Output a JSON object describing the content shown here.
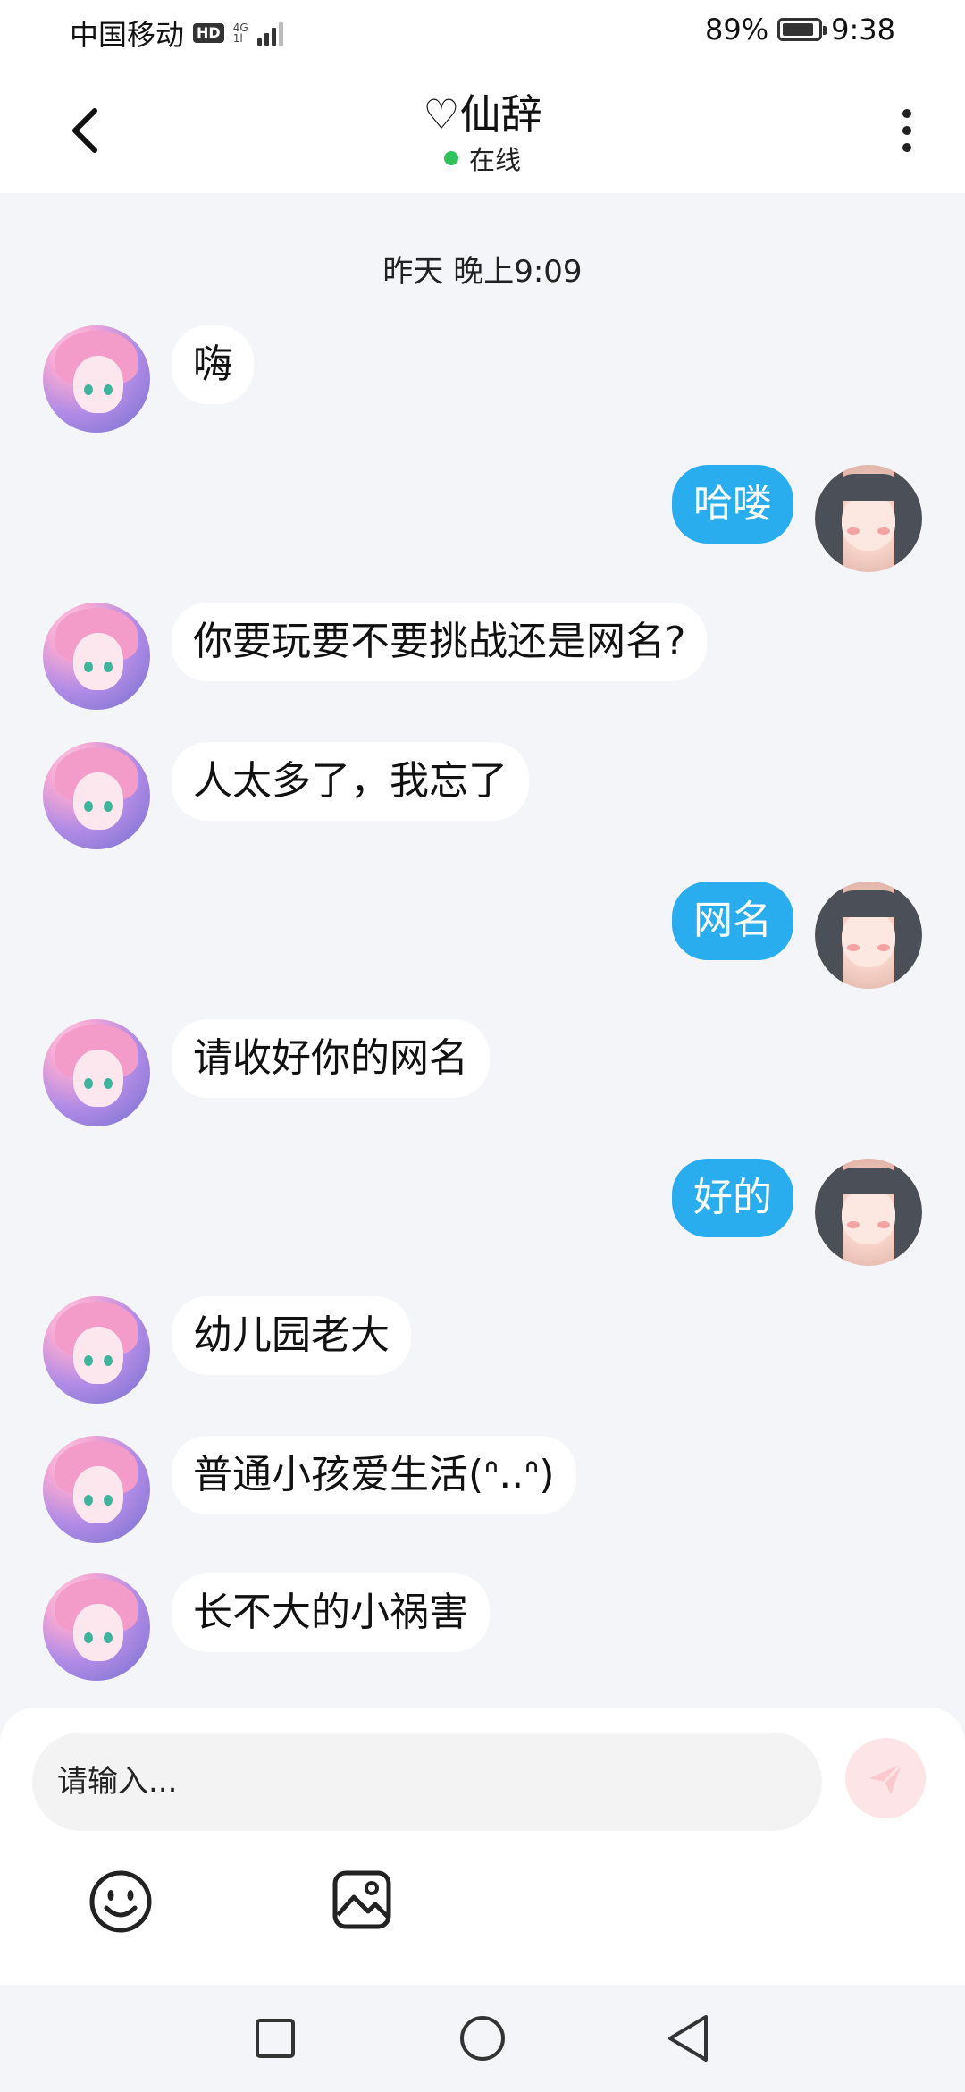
{
  "status_bar": {
    "carrier": "中国移动",
    "hd": "HD",
    "network_top": "4G",
    "network_bottom": "1l",
    "battery_percent": "89%",
    "battery_level": 0.89,
    "time": "9:38"
  },
  "header": {
    "title": "♡仙辞",
    "status": "在线",
    "status_color": "#31c35b",
    "back_icon": "chevron-left-icon",
    "more_icon": "more-vertical-icon"
  },
  "chat": {
    "timestamp": "昨天 晚上9:09",
    "messages": [
      {
        "side": "left",
        "text": "嗨"
      },
      {
        "side": "right",
        "text": "哈喽"
      },
      {
        "side": "left",
        "text": "你要玩要不要挑战还是网名?"
      },
      {
        "side": "left",
        "text": "人太多了，我忘了"
      },
      {
        "side": "right",
        "text": "网名"
      },
      {
        "side": "left",
        "text": "请收好你的网名"
      },
      {
        "side": "right",
        "text": "好的"
      },
      {
        "side": "left",
        "text": "幼儿园老大"
      },
      {
        "side": "left",
        "text": "普通小孩爱生活(ᐢ..ᐢ)"
      },
      {
        "side": "left",
        "text": "长不大的小祸害"
      }
    ]
  },
  "input_bar": {
    "placeholder": "请输入...",
    "send_icon": "paper-plane-icon",
    "send_color": "#fde4e6",
    "emoji_icon": "smiley-icon",
    "image_icon": "image-icon"
  },
  "nav_bar": {
    "recent_icon": "square-icon",
    "home_icon": "circle-icon",
    "back_icon": "triangle-back-icon"
  },
  "colors": {
    "bubble_self": "#29adef",
    "bubble_other": "#ffffff",
    "background": "#f4f5f9"
  }
}
